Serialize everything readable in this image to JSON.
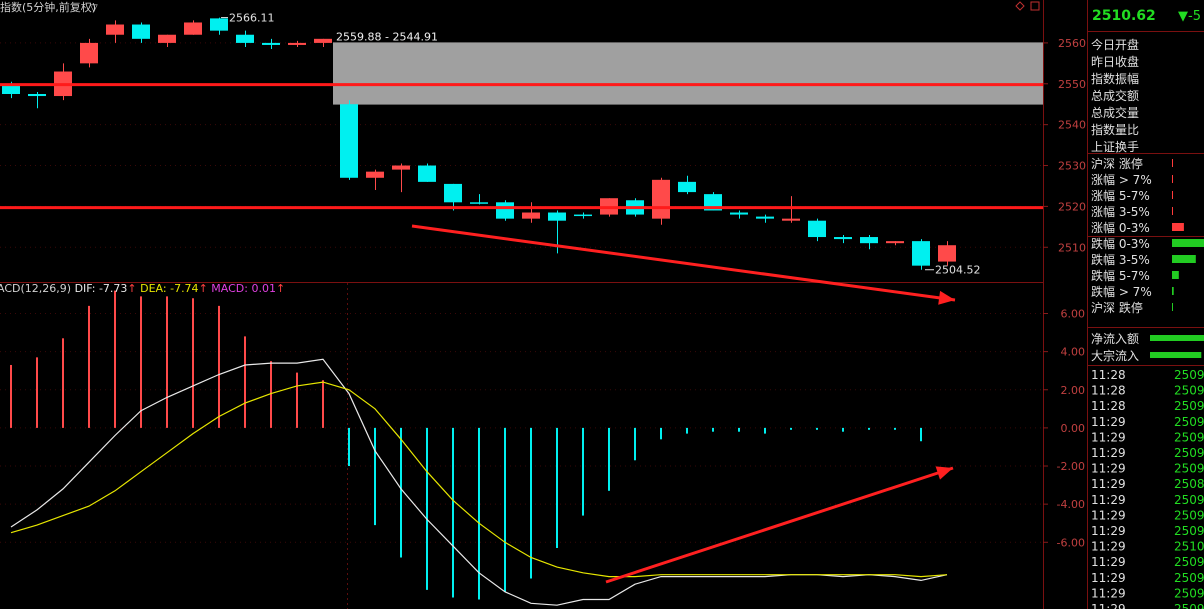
{
  "header": {
    "title": "指数(5分钟,前复权)",
    "title_arrow": "▽",
    "corner_icons": [
      "diamond-icon",
      "window-icon"
    ]
  },
  "annotations": {
    "high_label": "2566.11",
    "range_label": "2559.88 - 2544.91",
    "low_label": "2504.52"
  },
  "macd_header": {
    "name": "ACD(12,26,9)",
    "dif": "DIF: -7.73",
    "dea": "DEA: -7.74",
    "macd": "MACD: 0.01",
    "arrow": "↑"
  },
  "right_panel": {
    "price": "2510.62",
    "change": "▼-5",
    "fields": [
      "今日开盘",
      "昨日收盘",
      "指数振幅",
      "总成交额",
      "总成交量",
      "指数量比",
      "上证换手"
    ],
    "breadth": [
      {
        "label": "沪深 涨停",
        "level": 0.02,
        "color": "#ff3b3b"
      },
      {
        "label": "涨幅 > 7%",
        "level": 0.02,
        "color": "#ff3b3b"
      },
      {
        "label": "涨幅 5-7%",
        "level": 0.02,
        "color": "#ff3b3b"
      },
      {
        "label": "涨幅 3-5%",
        "level": 0.02,
        "color": "#ff3b3b"
      },
      {
        "label": "涨幅 0-3%",
        "level": 0.35,
        "color": "#ff3b3b"
      },
      {
        "label": "跌幅 0-3%",
        "level": 1.0,
        "color": "#22cc22"
      },
      {
        "label": "跌幅 3-5%",
        "level": 0.7,
        "color": "#22cc22"
      },
      {
        "label": "跌幅 5-7%",
        "level": 0.2,
        "color": "#22cc22"
      },
      {
        "label": "跌幅 > 7%",
        "level": 0.05,
        "color": "#22cc22"
      },
      {
        "label": "沪深 跌停",
        "level": 0.02,
        "color": "#22cc22"
      }
    ],
    "flows": [
      {
        "label": "净流入额",
        "level": 1.0,
        "color": "#22cc22"
      },
      {
        "label": "大宗流入",
        "level": 0.95,
        "color": "#22cc22"
      }
    ],
    "ticks": [
      {
        "time": "11:28",
        "price": "2509."
      },
      {
        "time": "11:28",
        "price": "2509."
      },
      {
        "time": "11:28",
        "price": "2509."
      },
      {
        "time": "11:29",
        "price": "2509."
      },
      {
        "time": "11:29",
        "price": "2509."
      },
      {
        "time": "11:29",
        "price": "2509."
      },
      {
        "time": "11:29",
        "price": "2509."
      },
      {
        "time": "11:29",
        "price": "2508."
      },
      {
        "time": "11:29",
        "price": "2509."
      },
      {
        "time": "11:29",
        "price": "2509."
      },
      {
        "time": "11:29",
        "price": "2509."
      },
      {
        "time": "11:29",
        "price": "2510."
      },
      {
        "time": "11:29",
        "price": "2509."
      },
      {
        "time": "11:29",
        "price": "2509."
      },
      {
        "time": "11:29",
        "price": "2509."
      },
      {
        "time": "11:29",
        "price": "2509."
      }
    ]
  },
  "chart_data": {
    "type": "candlestick",
    "price_axis": {
      "ticks": [
        "2560",
        "2550",
        "2540",
        "2530",
        "2520",
        "2510"
      ],
      "range": [
        2501.5,
        2570.5
      ]
    },
    "macd_axis": {
      "ticks": [
        "6.00",
        "4.00",
        "2.00",
        "0.00",
        "-2.00",
        "-4.00",
        "-6.00"
      ],
      "range": [
        -9.5,
        7.6
      ]
    },
    "candles": [
      {
        "o": 2549.5,
        "h": 2550.5,
        "l": 2546.5,
        "c": 2547.5
      },
      {
        "o": 2547.5,
        "h": 2548.0,
        "l": 2544.0,
        "c": 2547.0
      },
      {
        "o": 2547.0,
        "h": 2555.0,
        "l": 2546.0,
        "c": 2553.0
      },
      {
        "o": 2555.0,
        "h": 2561.0,
        "l": 2554.0,
        "c": 2560.0
      },
      {
        "o": 2562.0,
        "h": 2565.5,
        "l": 2560.0,
        "c": 2564.5
      },
      {
        "o": 2564.5,
        "h": 2565.0,
        "l": 2560.0,
        "c": 2561.0
      },
      {
        "o": 2560.0,
        "h": 2562.0,
        "l": 2559.0,
        "c": 2562.0
      },
      {
        "o": 2562.0,
        "h": 2565.5,
        "l": 2562.0,
        "c": 2565.0
      },
      {
        "o": 2566.0,
        "h": 2566.2,
        "l": 2562.0,
        "c": 2563.0
      },
      {
        "o": 2562.0,
        "h": 2563.0,
        "l": 2559.0,
        "c": 2560.0
      },
      {
        "o": 2560.0,
        "h": 2561.0,
        "l": 2558.5,
        "c": 2559.5
      },
      {
        "o": 2559.5,
        "h": 2560.5,
        "l": 2559.0,
        "c": 2560.0
      },
      {
        "o": 2560.0,
        "h": 2561.0,
        "l": 2559.0,
        "c": 2561.0
      },
      {
        "o": 2545.0,
        "h": 2546.0,
        "l": 2526.5,
        "c": 2527.0
      },
      {
        "o": 2527.0,
        "h": 2529.0,
        "l": 2524.0,
        "c": 2528.5
      },
      {
        "o": 2529.0,
        "h": 2530.5,
        "l": 2523.5,
        "c": 2530.0
      },
      {
        "o": 2530.0,
        "h": 2530.5,
        "l": 2526.0,
        "c": 2526.0
      },
      {
        "o": 2525.5,
        "h": 2525.5,
        "l": 2519.0,
        "c": 2521.0
      },
      {
        "o": 2521.0,
        "h": 2523.0,
        "l": 2520.5,
        "c": 2521.0
      },
      {
        "o": 2521.0,
        "h": 2521.5,
        "l": 2516.5,
        "c": 2517.0
      },
      {
        "o": 2517.0,
        "h": 2521.0,
        "l": 2516.0,
        "c": 2518.5
      },
      {
        "o": 2518.5,
        "h": 2519.0,
        "l": 2508.5,
        "c": 2516.5
      },
      {
        "o": 2518.0,
        "h": 2518.5,
        "l": 2517.0,
        "c": 2518.0
      },
      {
        "o": 2518.0,
        "h": 2522.0,
        "l": 2517.5,
        "c": 2522.0
      },
      {
        "o": 2521.5,
        "h": 2522.0,
        "l": 2517.5,
        "c": 2518.0
      },
      {
        "o": 2517.0,
        "h": 2527.0,
        "l": 2515.5,
        "c": 2526.5
      },
      {
        "o": 2526.0,
        "h": 2527.5,
        "l": 2523.0,
        "c": 2523.5
      },
      {
        "o": 2523.0,
        "h": 2523.5,
        "l": 2519.0,
        "c": 2519.0
      },
      {
        "o": 2518.5,
        "h": 2519.0,
        "l": 2517.0,
        "c": 2518.0
      },
      {
        "o": 2517.5,
        "h": 2518.0,
        "l": 2516.0,
        "c": 2517.0
      },
      {
        "o": 2516.5,
        "h": 2522.5,
        "l": 2516.0,
        "c": 2517.0
      },
      {
        "o": 2516.5,
        "h": 2517.0,
        "l": 2511.5,
        "c": 2512.5
      },
      {
        "o": 2512.5,
        "h": 2513.0,
        "l": 2511.0,
        "c": 2512.0
      },
      {
        "o": 2512.5,
        "h": 2513.0,
        "l": 2509.5,
        "c": 2511.0
      },
      {
        "o": 2511.0,
        "h": 2511.5,
        "l": 2510.5,
        "c": 2511.5
      },
      {
        "o": 2511.5,
        "h": 2512.0,
        "l": 2504.5,
        "c": 2505.5
      },
      {
        "o": 2506.5,
        "h": 2511.5,
        "l": 2505.5,
        "c": 2510.5
      }
    ],
    "macd_bars": [
      3.3,
      3.7,
      4.7,
      6.4,
      7.2,
      6.9,
      6.9,
      6.8,
      6.4,
      4.8,
      3.5,
      2.9,
      2.5,
      -2.0,
      -5.1,
      -6.8,
      -8.5,
      -8.9,
      -9.0,
      -8.6,
      -7.9,
      -6.3,
      -4.6,
      -3.3,
      -1.7,
      -0.6,
      -0.3,
      -0.2,
      -0.2,
      -0.3,
      -0.1,
      -0.1,
      -0.2,
      -0.1,
      -0.1,
      -0.7,
      0.0
    ],
    "dif": [
      -5.2,
      -4.3,
      -3.2,
      -1.8,
      -0.4,
      0.9,
      1.6,
      2.2,
      2.8,
      3.3,
      3.4,
      3.4,
      3.6,
      1.8,
      -1.2,
      -3.2,
      -4.8,
      -6.2,
      -7.6,
      -8.6,
      -9.2,
      -9.3,
      -9.0,
      -9.0,
      -8.2,
      -7.8,
      -7.8,
      -7.8,
      -7.8,
      -7.8,
      -7.7,
      -7.7,
      -7.8,
      -7.7,
      -7.8,
      -8.0,
      -7.7
    ],
    "dea": [
      -5.5,
      -5.1,
      -4.6,
      -4.1,
      -3.3,
      -2.3,
      -1.3,
      -0.3,
      0.6,
      1.3,
      1.8,
      2.2,
      2.4,
      2.0,
      1.0,
      -0.6,
      -2.3,
      -3.8,
      -5.0,
      -6.0,
      -6.8,
      -7.3,
      -7.6,
      -7.8,
      -7.8,
      -7.7,
      -7.7,
      -7.7,
      -7.7,
      -7.7,
      -7.7,
      -7.7,
      -7.7,
      -7.7,
      -7.7,
      -7.8,
      -7.7
    ],
    "resistance_band": [
      2544.91,
      2559.88
    ],
    "hlines": [
      2549.8,
      2519.7
    ]
  }
}
